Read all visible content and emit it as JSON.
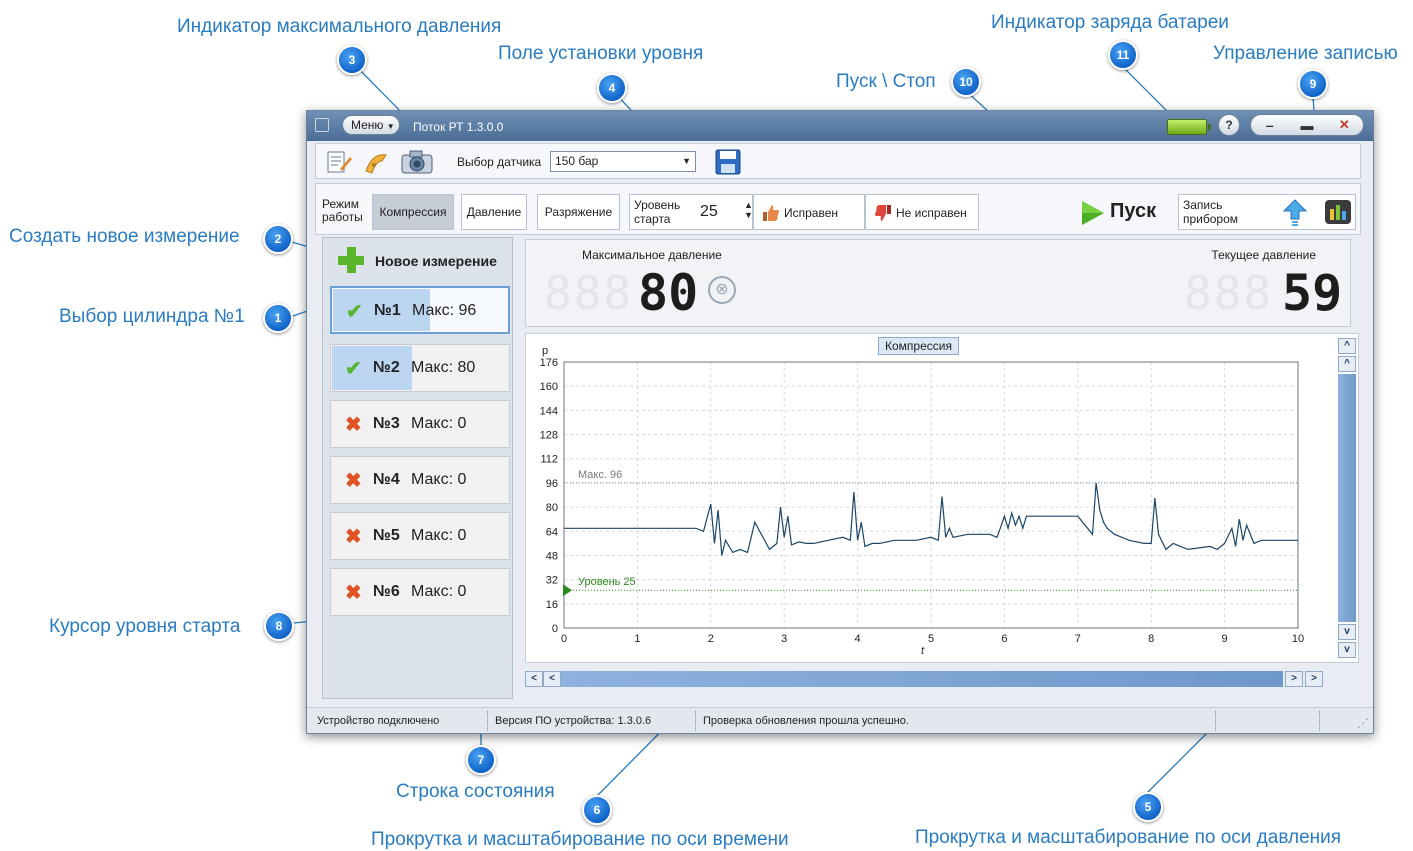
{
  "annotations": [
    {
      "num": "1",
      "label": "Выбор цилиндра №1"
    },
    {
      "num": "2",
      "label": "Создать новое измерение"
    },
    {
      "num": "3",
      "label": "Индикатор максимального давления"
    },
    {
      "num": "4",
      "label": "Поле установки уровня"
    },
    {
      "num": "5",
      "label": "Прокрутка и масштабирование по оси давления"
    },
    {
      "num": "6",
      "label": "Прокрутка и масштабирование по оси времени"
    },
    {
      "num": "7",
      "label": "Строка состояния"
    },
    {
      "num": "8",
      "label": "Курсор уровня старта"
    },
    {
      "num": "9",
      "label": "Управление записью"
    },
    {
      "num": "10",
      "label": "Пуск \\ Стоп"
    },
    {
      "num": "11",
      "label": "Индикатор заряда батареи"
    }
  ],
  "window": {
    "menu_label": "Меню",
    "title": "Поток РТ 1.3.0.0",
    "help": "?",
    "minimize": "‒",
    "maximize": "▬",
    "close": "✕"
  },
  "toolbar": {
    "sensor_label": "Выбор датчика",
    "sensor_value": "150 бар"
  },
  "mode": {
    "label_line1": "Режим",
    "label_line2": "работы",
    "buttons": [
      "Компрессия",
      "Давление",
      "Разряжение"
    ],
    "active": "Компрессия",
    "level_label_line1": "Уровень",
    "level_label_line2": "старта",
    "level_value": "25",
    "good_label": "Исправен",
    "bad_label": "Не исправен",
    "start_label": "Пуск",
    "record_line1": "Запись",
    "record_line2": "прибором"
  },
  "new_measurement": "Новое измерение",
  "cylinders": [
    {
      "num": "№1",
      "max_text": "Макс: 96",
      "status": "ok",
      "fill": 0.55
    },
    {
      "num": "№2",
      "max_text": "Макс: 80",
      "status": "ok",
      "fill": 0.45
    },
    {
      "num": "№3",
      "max_text": "Макс: 0",
      "status": "bad",
      "fill": 0
    },
    {
      "num": "№4",
      "max_text": "Макс: 0",
      "status": "bad",
      "fill": 0
    },
    {
      "num": "№5",
      "max_text": "Макс: 0",
      "status": "bad",
      "fill": 0
    },
    {
      "num": "№6",
      "max_text": "Макс: 0",
      "status": "bad",
      "fill": 0
    }
  ],
  "indicators": {
    "max_label": "Максимальное давление",
    "max_value": "80",
    "current_label": "Текущее давление",
    "current_value": "59"
  },
  "chart_data": {
    "type": "line",
    "title": "Компрессия",
    "xlabel": "t",
    "ylabel": "p",
    "xlim": [
      0,
      10
    ],
    "ylim": [
      0,
      176
    ],
    "xticks": [
      0,
      1,
      2,
      3,
      4,
      5,
      6,
      7,
      8,
      9,
      10
    ],
    "yticks": [
      0,
      16,
      32,
      48,
      64,
      80,
      96,
      112,
      128,
      144,
      160,
      176
    ],
    "grid": true,
    "max_line": {
      "value": 96,
      "label": "Макс. 96"
    },
    "level_line": {
      "value": 25,
      "label": "Уровень 25"
    },
    "series": [
      {
        "x": [
          0,
          1.8,
          1.9,
          2.0,
          2.05,
          2.1,
          2.15,
          2.2,
          2.3,
          2.4,
          2.5,
          2.6,
          2.8,
          2.9,
          2.95,
          3.0,
          3.05,
          3.1,
          3.2,
          3.3,
          3.4,
          3.6,
          3.8,
          3.9,
          3.95,
          4.0,
          4.05,
          4.1,
          4.2,
          4.3,
          4.5,
          4.8,
          5.0,
          5.1,
          5.15,
          5.2,
          5.25,
          5.3,
          5.5,
          5.8,
          5.9,
          6.0,
          6.05,
          6.1,
          6.15,
          6.2,
          6.25,
          6.3,
          6.4,
          7.0,
          7.2,
          7.25,
          7.3,
          7.35,
          7.4,
          7.5,
          7.7,
          7.9,
          8.0,
          8.05,
          8.1,
          8.2,
          8.3,
          8.5,
          8.8,
          8.9,
          9.0,
          9.1,
          9.15,
          9.2,
          9.25,
          9.3,
          9.4,
          9.5,
          10.0
        ],
        "y": [
          66,
          66,
          64,
          82,
          56,
          78,
          48,
          58,
          50,
          52,
          50,
          70,
          52,
          56,
          80,
          60,
          74,
          55,
          57,
          56,
          56,
          58,
          60,
          58,
          90,
          58,
          70,
          54,
          56,
          56,
          58,
          58,
          60,
          58,
          87,
          60,
          66,
          60,
          62,
          62,
          60,
          74,
          66,
          76,
          68,
          74,
          66,
          74,
          74,
          74,
          62,
          96,
          78,
          70,
          66,
          62,
          58,
          56,
          56,
          86,
          62,
          52,
          56,
          52,
          54,
          52,
          56,
          66,
          54,
          72,
          58,
          68,
          56,
          58,
          58
        ]
      }
    ]
  },
  "status": {
    "connected": "Устройство подключено",
    "firmware": "Версия ПО устройства: 1.3.0.6",
    "update": "Проверка обновления прошла успешно."
  },
  "colors": {
    "accent": "#2a7cc0",
    "badge": "#1a73d8",
    "titlebar": "#557aa3",
    "line": "#1b4668",
    "level": "#2c8a1e",
    "ok": "#58b431",
    "bad": "#e05325"
  }
}
